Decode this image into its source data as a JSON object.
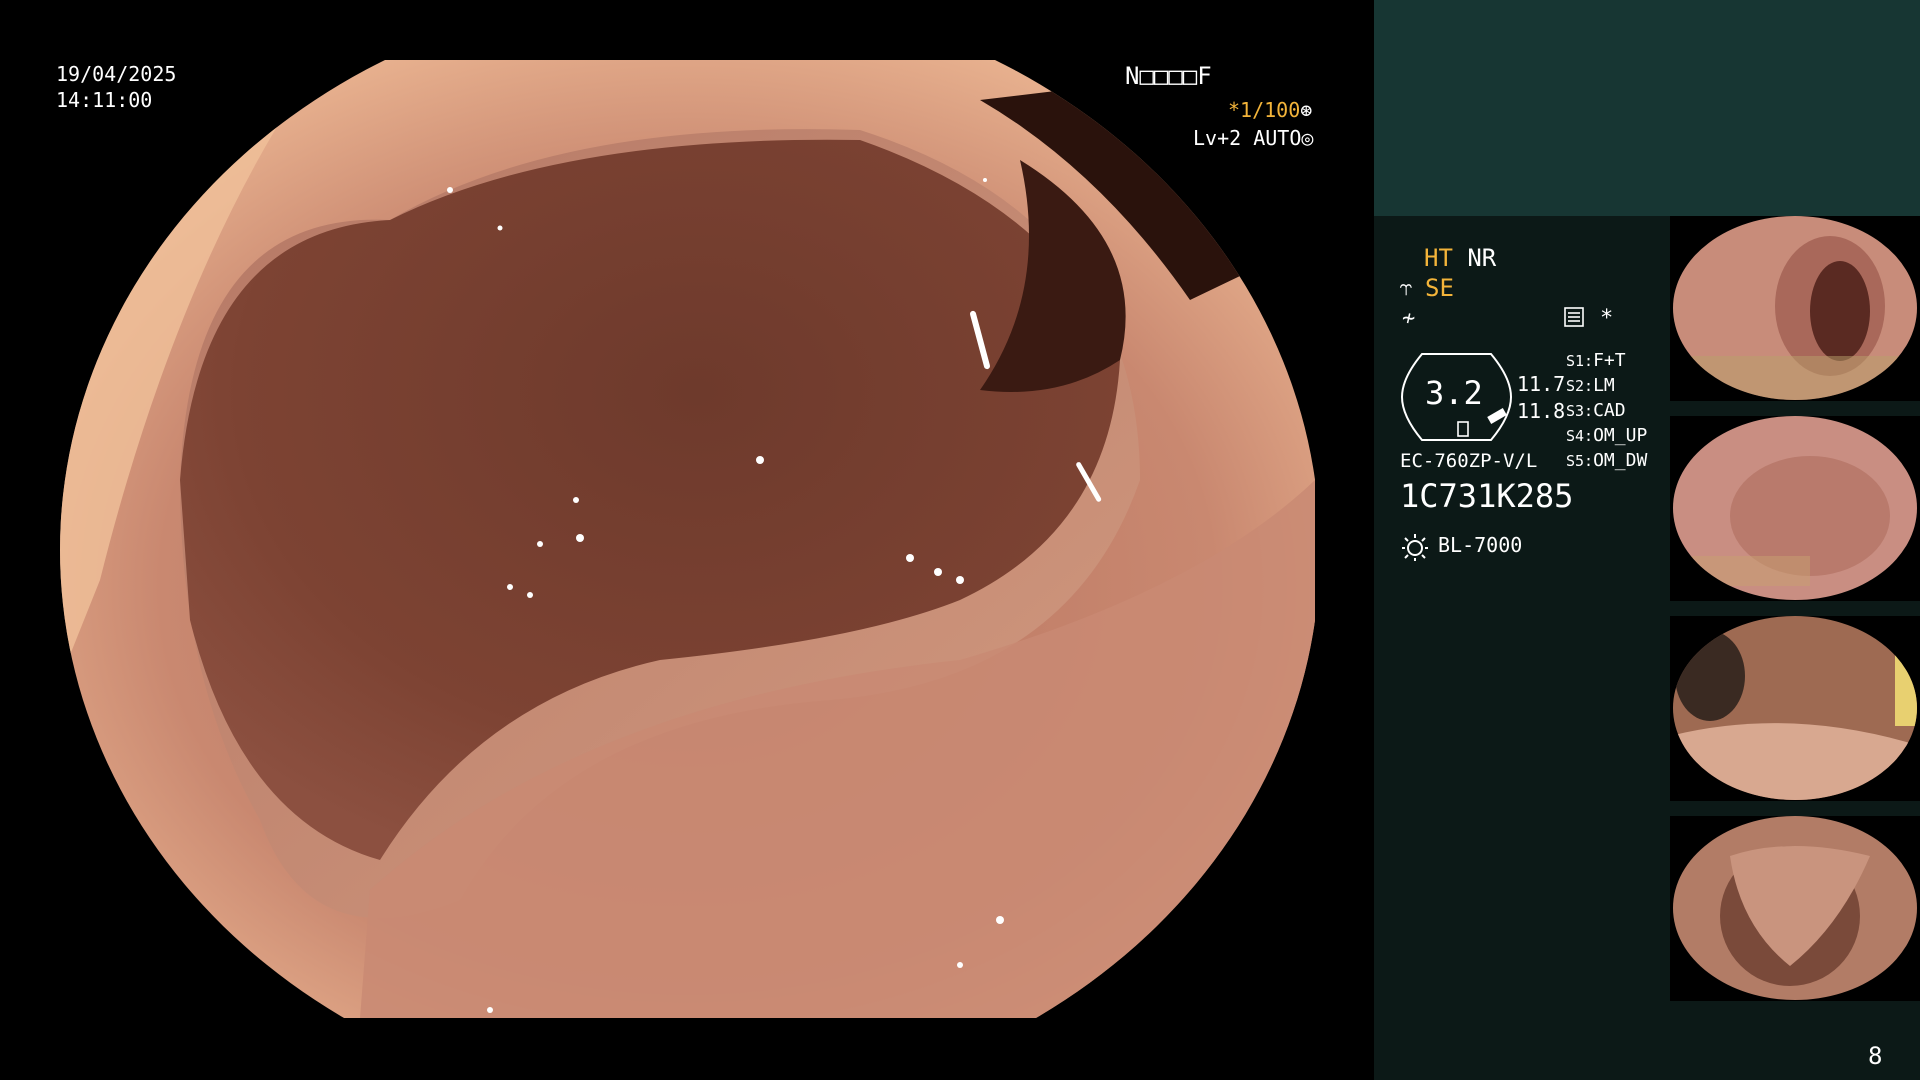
{
  "overlay": {
    "date": "19/04/2025",
    "time": "14:11:00",
    "patient_id": "N□□□□F",
    "shutter_prefix": "*1/100",
    "shutter_icon": "aperture-icon",
    "level": "Lv+2",
    "auto": "AUTO",
    "auto_icon": "target-icon"
  },
  "panel": {
    "ht": "HT",
    "nr": "NR",
    "se": "SE",
    "star": "*",
    "hex_value": "3.2",
    "value1": "11.7",
    "value2": "11.8",
    "slots": [
      {
        "key": "S1:",
        "label": "F+T"
      },
      {
        "key": "S2:",
        "label": "LM"
      },
      {
        "key": "S3:",
        "label": "CAD"
      },
      {
        "key": "S4:",
        "label": "OM_UP"
      },
      {
        "key": "S5:",
        "label": "OM_DW"
      }
    ],
    "scope_model": "EC-760ZP-V/L",
    "serial": "1C731K285",
    "light_source": "BL-7000",
    "page_number": "8"
  },
  "colors": {
    "panel_bg": "#0c1917",
    "panel_top": "#173633",
    "accent_orange": "#f3b43a"
  }
}
